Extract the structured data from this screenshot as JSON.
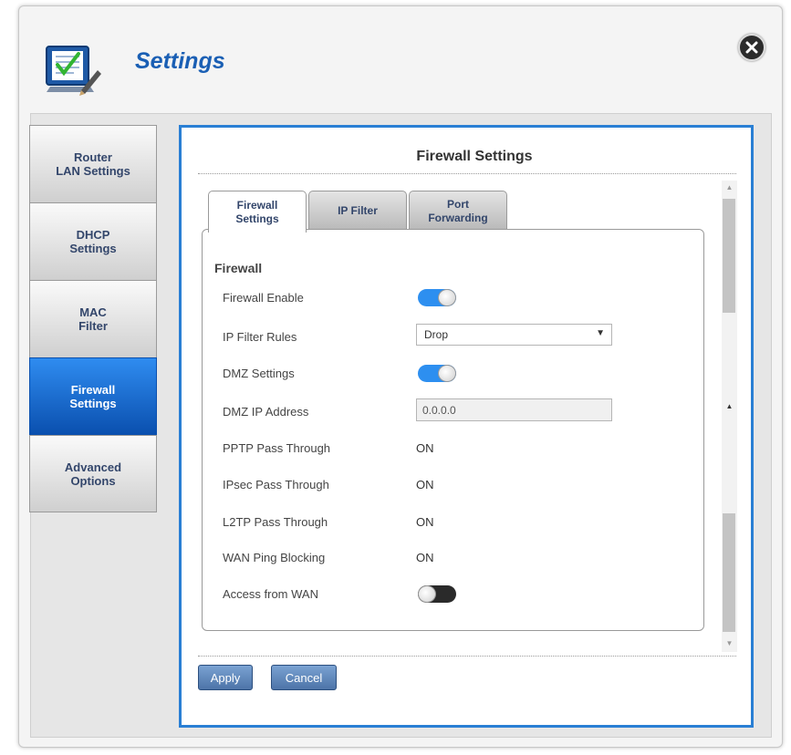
{
  "window": {
    "title": "Settings",
    "close_label": "close"
  },
  "sidebar": {
    "items": [
      {
        "label": "Router\nLAN Settings",
        "active": false
      },
      {
        "label": "DHCP\nSettings",
        "active": false
      },
      {
        "label": "MAC\nFilter",
        "active": false
      },
      {
        "label": "Firewall\nSettings",
        "active": true
      },
      {
        "label": "Advanced\nOptions",
        "active": false
      }
    ]
  },
  "panel": {
    "title": "Firewall Settings",
    "tabs": [
      {
        "label": "Firewall\nSettings",
        "active": true
      },
      {
        "label": "IP Filter",
        "active": false
      },
      {
        "label": "Port\nForwarding",
        "active": false
      }
    ],
    "section_title": "Firewall",
    "rows": {
      "firewall_enable": {
        "label": "Firewall Enable",
        "state": "on"
      },
      "ip_filter_rules": {
        "label": "IP Filter Rules",
        "value": "Drop",
        "options": [
          "Drop"
        ]
      },
      "dmz_settings": {
        "label": "DMZ Settings",
        "state": "on"
      },
      "dmz_ip": {
        "label": "DMZ IP Address",
        "value": "0.0.0.0"
      },
      "pptp": {
        "label": "PPTP Pass Through",
        "value": "ON"
      },
      "ipsec": {
        "label": "IPsec Pass Through",
        "value": "ON"
      },
      "l2tp": {
        "label": "L2TP Pass Through",
        "value": "ON"
      },
      "wan_ping": {
        "label": "WAN Ping Blocking",
        "value": "ON"
      },
      "access_wan": {
        "label": "Access from WAN",
        "state": "off"
      }
    }
  },
  "buttons": {
    "apply": "Apply",
    "cancel": "Cancel"
  },
  "colors": {
    "accent": "#2a7fd4",
    "active_tab": "#0a4fae",
    "toggle_on": "#2d8ff0",
    "toggle_off": "#2a2a2a"
  },
  "icons": {
    "app": "settings-checklist-icon",
    "close": "close-icon"
  }
}
